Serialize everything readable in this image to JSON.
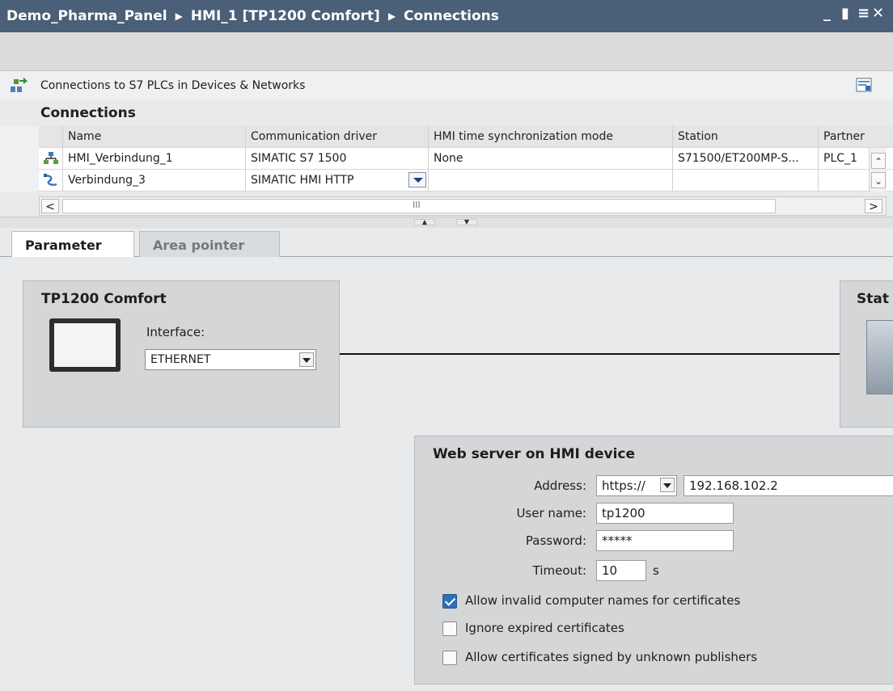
{
  "window": {
    "breadcrumb": [
      "Demo_Pharma_Panel",
      "HMI_1 [TP1200 Comfort]",
      "Connections"
    ],
    "controls": {
      "minimize": "_",
      "restore": "▮",
      "menu": "≡",
      "close": "✕"
    }
  },
  "connections_header": {
    "title": "Connections to S7 PLCs in Devices & Networks"
  },
  "connections": {
    "section_title": "Connections",
    "columns": [
      "Name",
      "Communication driver",
      "HMI time synchronization mode",
      "Station",
      "Partner"
    ],
    "rows": [
      {
        "icon": "network-connection-icon",
        "name": "HMI_Verbindung_1",
        "driver": "SIMATIC S7 1500",
        "sync_mode": "None",
        "station": "S71500/ET200MP-S...",
        "partner": "PLC_1"
      },
      {
        "icon": "http-connection-icon",
        "name": "Verbindung_3",
        "driver": "SIMATIC HMI HTTP",
        "sync_mode": "",
        "station": "",
        "partner": ""
      }
    ],
    "hscroll_grip": "III"
  },
  "tabs": [
    {
      "label": "Parameter",
      "active": true
    },
    {
      "label": "Area pointer",
      "active": false
    }
  ],
  "device": {
    "title": "TP1200 Comfort",
    "interface_label": "Interface:",
    "interface_value": "ETHERNET"
  },
  "station": {
    "title": "Stat"
  },
  "webserver": {
    "title": "Web server on HMI device",
    "address_label": "Address:",
    "protocol": "https://",
    "address": "192.168.102.2",
    "username_label": "User name:",
    "username": "tp1200",
    "password_label": "Password:",
    "password": "*****",
    "timeout_label": "Timeout:",
    "timeout": "10",
    "timeout_unit": "s",
    "options": [
      {
        "label": "Allow invalid computer names for certificates",
        "checked": true
      },
      {
        "label": "Ignore expired certificates",
        "checked": false
      },
      {
        "label": "Allow certificates signed by unknown publishers",
        "checked": false
      }
    ]
  },
  "colors": {
    "titlebar": "#4a5f78",
    "checkbox_checked": "#2e6fb5"
  }
}
